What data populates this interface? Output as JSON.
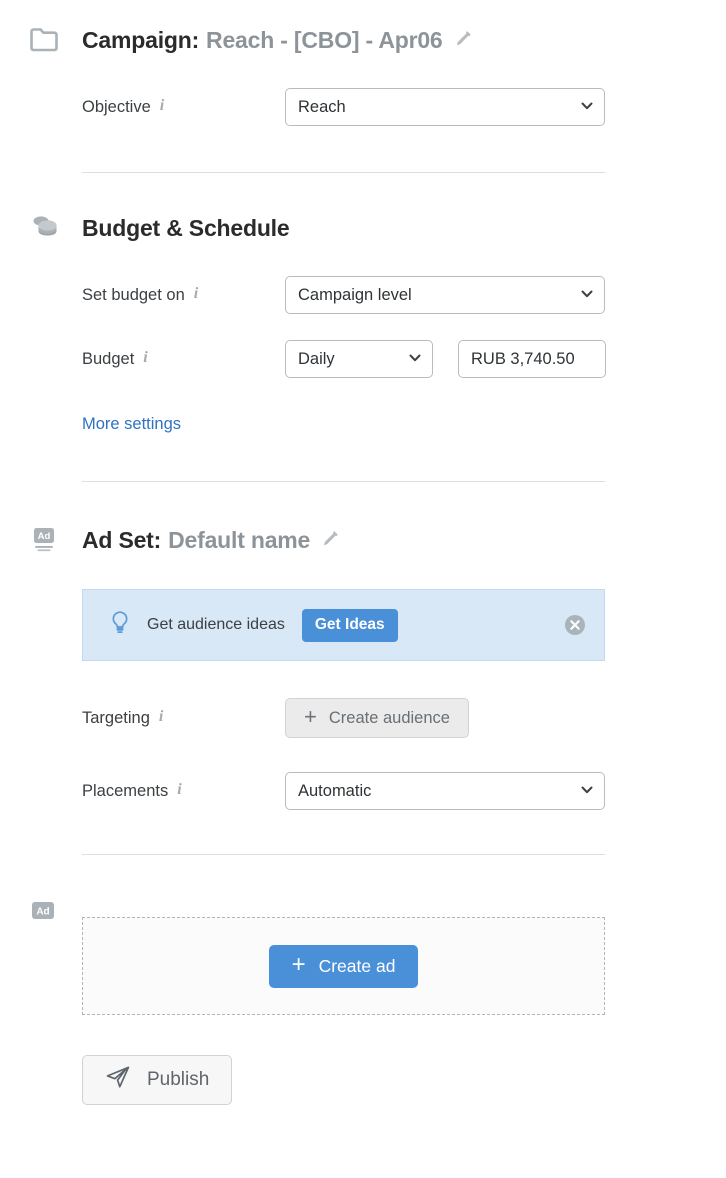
{
  "campaign": {
    "icon": "folder-icon",
    "title_prefix": "Campaign:",
    "name": "Reach - [CBO] - Apr06",
    "edit_icon": "pencil-icon",
    "objective": {
      "label": "Objective",
      "info_icon": "info-icon",
      "value": "Reach",
      "chevron_icon": "chevron-down-icon"
    }
  },
  "budget_schedule": {
    "icon": "coins-icon",
    "title": "Budget & Schedule",
    "set_budget_on": {
      "label": "Set budget on",
      "info_icon": "info-icon",
      "value": "Campaign level",
      "chevron_icon": "chevron-down-icon"
    },
    "budget": {
      "label": "Budget",
      "info_icon": "info-icon",
      "period_value": "Daily",
      "chevron_icon": "chevron-down-icon",
      "amount_value": "RUB 3,740.50"
    },
    "more_settings_link": "More settings"
  },
  "ad_set": {
    "icon": "ad-screen-icon",
    "title_prefix": "Ad Set:",
    "name": "Default name",
    "edit_icon": "pencil-icon",
    "banner": {
      "bulb_icon": "lightbulb-icon",
      "text": "Get audience ideas",
      "button_label": "Get Ideas",
      "close_icon": "close-circle-icon"
    },
    "targeting": {
      "label": "Targeting",
      "info_icon": "info-icon",
      "button_label": "Create audience",
      "plus_icon": "plus-icon"
    },
    "placements": {
      "label": "Placements",
      "info_icon": "info-icon",
      "value": "Automatic",
      "chevron_icon": "chevron-down-icon"
    }
  },
  "ad": {
    "icon": "ad-badge-icon",
    "create_ad_label": "Create ad",
    "plus_icon": "plus-icon"
  },
  "publish": {
    "label": "Publish",
    "icon": "paper-plane-icon"
  },
  "colors": {
    "accent_blue": "#4a90d9",
    "link_blue": "#2f72c4",
    "banner_bg": "#d8e8f7",
    "muted_text": "#8d9499",
    "icon_gray": "#aab2b8"
  }
}
